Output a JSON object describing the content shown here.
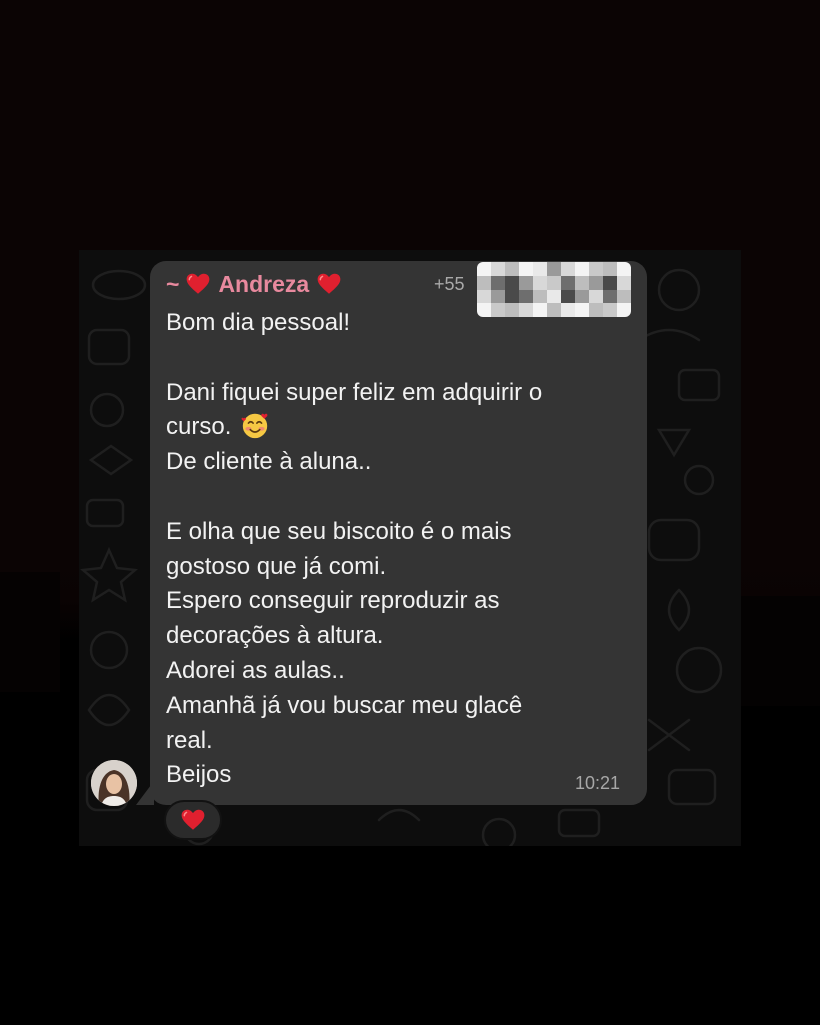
{
  "message": {
    "sender_prefix": "~",
    "sender_name": "Andreza",
    "phone_prefix": "+55",
    "lines": [
      "Bom dia pessoal!",
      "",
      "Dani fiquei super feliz em adquirir o",
      "curso.",
      "De cliente à aluna..",
      "",
      "E olha que seu biscoito é o mais",
      "gostoso que já comi.",
      "Espero conseguir reproduzir as",
      "decorações à altura.",
      "Adorei as aulas..",
      "Amanhã já vou buscar meu glacê",
      "real.",
      "Beijos"
    ],
    "time": "10:21",
    "reaction": "heart-emoji"
  },
  "colors": {
    "bubble": "#343434",
    "sender_name": "#e8899e",
    "message_text": "#f2f2f2",
    "timestamp": "#a7a7a7",
    "heart": "#e0202f"
  }
}
